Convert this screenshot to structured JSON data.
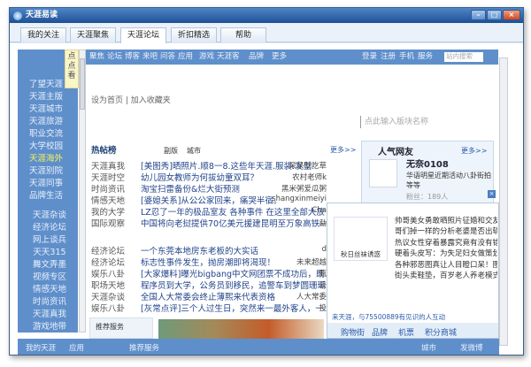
{
  "window": {
    "title": "天涯易读",
    "minimize": "–",
    "maximize": "□",
    "close": "×"
  },
  "tabs": [
    "我的关注",
    "天涯聚焦",
    "天涯论坛",
    "折扣精选",
    "帮助"
  ],
  "sidebar": {
    "handle": "点点看",
    "groups1": [
      "了望天涯",
      "天涯主版",
      "天涯城市",
      "天涯旅游",
      "职业交流",
      "大学校园",
      "天涯海外",
      "天涯别院",
      "天涯同事",
      "品牌生活"
    ],
    "groups2": [
      "天涯杂谈",
      "经济论坛",
      "网上谈兵",
      "天天315",
      "舞文弄墨",
      "视频专区",
      "情感天地",
      "时尚资讯",
      "天涯真我",
      "游戏地带"
    ]
  },
  "nav": {
    "left": [
      "聚焦",
      "论坛",
      "博客",
      "来吧",
      "问答",
      "应用",
      "游戏",
      "天涯客",
      "品牌",
      "更多"
    ],
    "right": [
      "登录",
      "注册",
      "手机",
      "服务"
    ],
    "search_placeholder": "站内搜索"
  },
  "main": {
    "home_links": "设为首页 | 加入收藏夹",
    "board_search_placeholder": "点此输入版块名称",
    "hot_title": "热帖榜",
    "sub_tabs": [
      "副版",
      "城市"
    ],
    "more": "更多>>",
    "posts": [
      {
        "cat": "天涯真我",
        "title": "[美图秀]晒照片.顺8一8.这些年天涯.服装.发型.",
        "author": "呆呆就吃草"
      },
      {
        "cat": "天涯时空",
        "title": "幼儿园女教师为何拔幼童双耳？",
        "author": "农村老师k"
      },
      {
        "cat": "时尚资讯",
        "title": "淘宝扫雷备份&烂大街预测",
        "author": "黑米粥爱瓜粥"
      },
      {
        "cat": "情感天地",
        "title": "[婆媳关系]从公公家回来，痛哭半宿。",
        "author": "shangxinmeiyi"
      },
      {
        "cat": "我的大学",
        "title": "LZ忍了一年的极品室友 各种事件 在这里全部大放",
        "author": "Cha"
      },
      {
        "cat": "国际观察",
        "title": "中国将向老挝提供70亿美元援建昆明至万象高铁~",
        "author": "勐"
      },
      {
        "cat": "经济论坛",
        "title": "一个东莞本地房东老板的大实话",
        "author": "d"
      },
      {
        "cat": "经济论坛",
        "title": "标志性事件发生，抛房潮即将渴现！",
        "author": "未来超越"
      },
      {
        "cat": "娱乐八卦",
        "title": "[大家爆料]曝光bigbang中文网团票不成功后，既",
        "author": "甄"
      },
      {
        "cat": "职场天地",
        "title": "程序员到大学，公务员到移民，追警车到梦圆珊瑚",
        "author": "云"
      },
      {
        "cat": "天涯杂谈",
        "title": "全国人大常委会终止薄熙来代表资格",
        "author": "人大常委"
      },
      {
        "cat": "娱乐八卦",
        "title": "[灰常点评]三个人过生日，突然来一最外客人，一",
        "author": "投"
      }
    ],
    "recommend_title": "推荐服务"
  },
  "popular": {
    "title": "人气网友",
    "more": "更多>>",
    "name": "无奈0108",
    "desc": "华语明星近期活动八卦街拍等等",
    "fans": "粉丝：189人"
  },
  "popup": {
    "image_caption": "秋日丝袜诱惑",
    "lines": [
      "帅哥美女勇敢晒照片征婚和交友",
      "哥们掉一样的分析老婆是否出轨",
      "热议女性穿着暴露究竟有没有错",
      "硬着头皮写：为失足妇女做策划",
      "各种邪恶图真让人目瞪口呆！图",
      "街头卖鞋垫，百岁老人养老模式"
    ],
    "footer": "来天涯，与75500889有见识的人互动",
    "links": [
      "购物街",
      "品牌",
      "机票",
      "积分商城"
    ]
  },
  "bottom": {
    "left": [
      "我的天涯",
      "应用",
      "推荐服务"
    ],
    "right": [
      "城市",
      "发微博"
    ]
  }
}
